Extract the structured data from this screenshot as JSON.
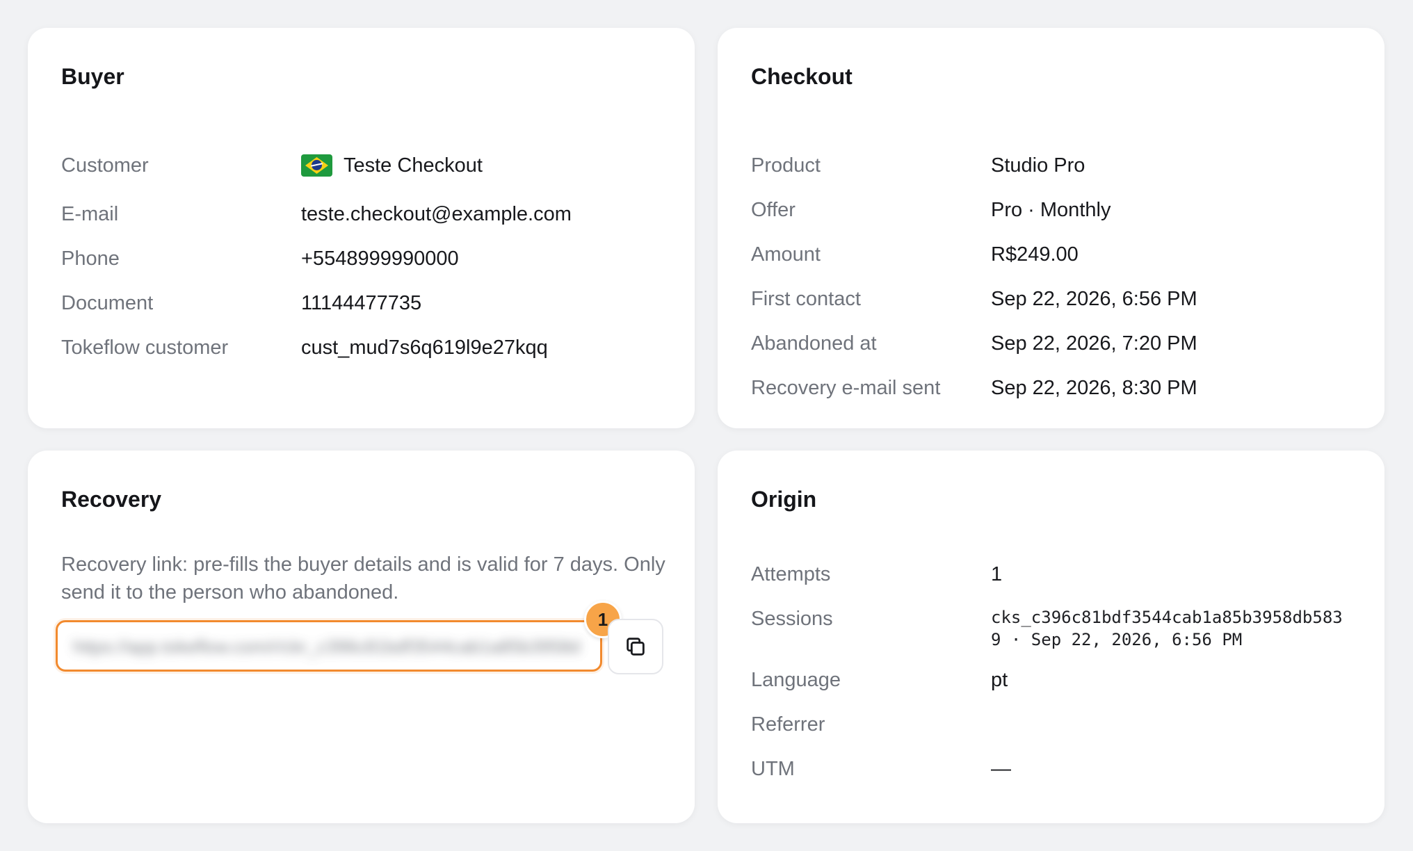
{
  "buyer": {
    "title": "Buyer",
    "rows": [
      {
        "label": "Customer",
        "value": "Teste Checkout",
        "flag_icon": "brazil-flag-icon"
      },
      {
        "label": "E-mail",
        "value": "teste.checkout@example.com"
      },
      {
        "label": "Phone",
        "value": "+5548999990000"
      },
      {
        "label": "Document",
        "value": "11144477735"
      },
      {
        "label": "Tokeflow customer",
        "value": "cust_mud7s6q619l9e27kqq"
      }
    ]
  },
  "checkout": {
    "title": "Checkout",
    "rows": [
      {
        "label": "Product",
        "value": "Studio Pro"
      },
      {
        "label": "Offer",
        "value": "Pro · Monthly"
      },
      {
        "label": "Amount",
        "value": "R$249.00"
      },
      {
        "label": "First contact",
        "value": "Sep 22, 2026, 6:56 PM"
      },
      {
        "label": "Abandoned at",
        "value": "Sep 22, 2026, 7:20 PM"
      },
      {
        "label": "Recovery e-mail sent",
        "value": "Sep 22, 2026, 8:30 PM"
      }
    ]
  },
  "recovery": {
    "title": "Recovery",
    "description": "Recovery link: pre-fills the buyer details and is valid for 7 days. Only send it to the person who abandoned.",
    "link_blurred": "https://app.tokeflow.com/r/ckr_c396c81bdf3544cab1a85b3958db5839",
    "badge": "1",
    "copy_icon": "copy-icon"
  },
  "origin": {
    "title": "Origin",
    "rows": [
      {
        "label": "Attempts",
        "value": "1"
      },
      {
        "label": "Sessions",
        "value": "cks_c396c81bdf3544cab1a85b3958db583\n9 · Sep 22, 2026, 6:56 PM"
      },
      {
        "label": "Language",
        "value": "pt"
      },
      {
        "label": "Referrer",
        "value": ""
      },
      {
        "label": "UTM",
        "value": "—"
      }
    ]
  },
  "colors": {
    "background": "#f1f2f4",
    "card": "#ffffff",
    "label": "#6f737b",
    "accent_orange": "#f28a2e",
    "badge": "#f7a448"
  }
}
